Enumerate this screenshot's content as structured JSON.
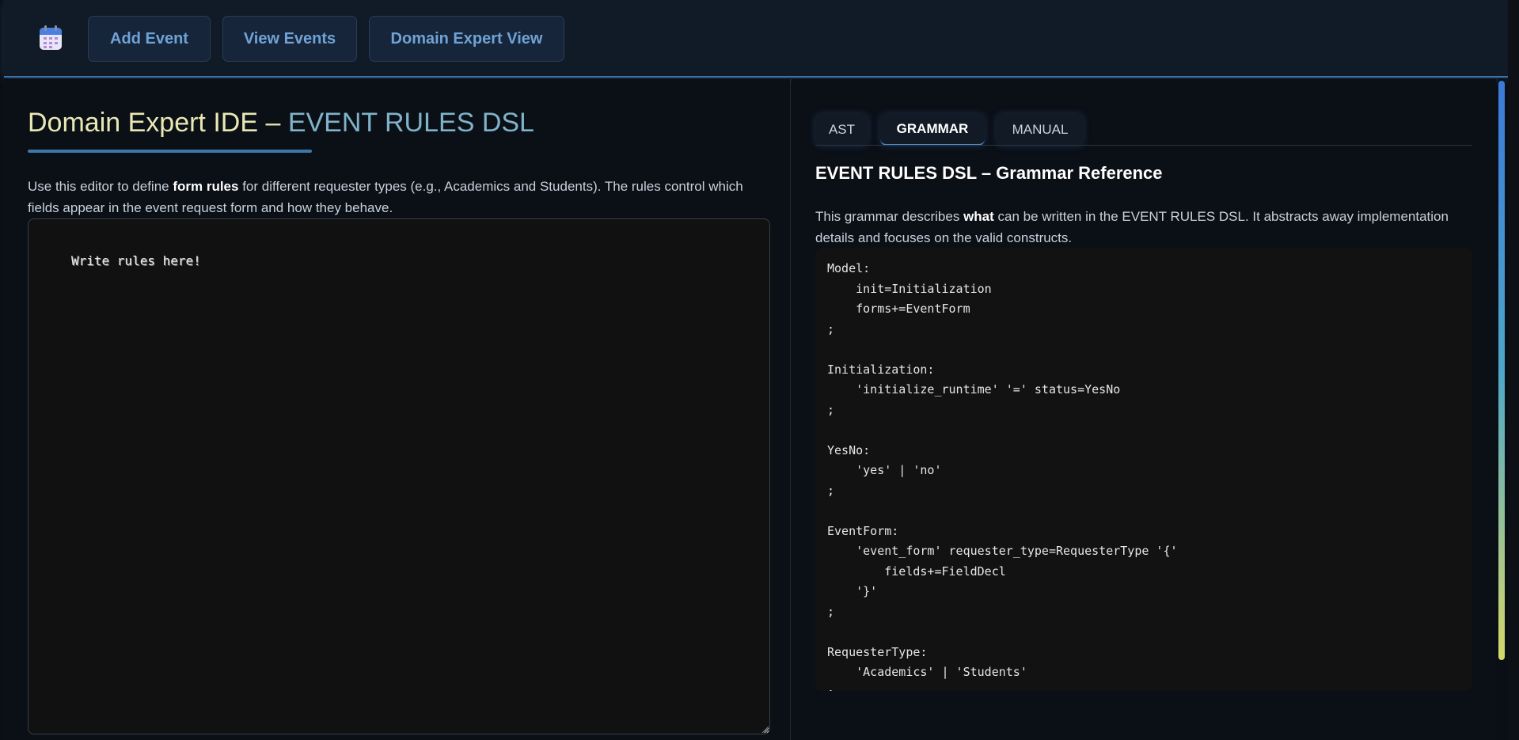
{
  "nav": {
    "app_icon": "calendar-icon",
    "buttons": [
      {
        "label": "Add Event"
      },
      {
        "label": "View Events"
      },
      {
        "label": "Domain Expert View"
      }
    ]
  },
  "left": {
    "title_part_a": "Domain Expert IDE –",
    "title_part_b": "EVENT RULES DSL",
    "intro_pre": "Use this editor to define ",
    "intro_bold": "form rules",
    "intro_post": " for different requester types (e.g., Academics and Students). The rules control which fields appear in the event request form and how they behave.",
    "editor_placeholder": "Write rules here!"
  },
  "right": {
    "tabs": [
      {
        "label": "AST",
        "active": false
      },
      {
        "label": "GRAMMAR",
        "active": true
      },
      {
        "label": "MANUAL",
        "active": false
      }
    ],
    "heading": "EVENT RULES DSL – Grammar Reference",
    "desc_pre": "This grammar describes ",
    "desc_bold": "what",
    "desc_post": " can be written in the EVENT RULES DSL. It abstracts away implementation details and focuses on the valid constructs.",
    "grammar_code": "Model:\n    init=Initialization\n    forms+=EventForm\n;\n\nInitialization:\n    'initialize_runtime' '=' status=YesNo\n;\n\nYesNo:\n    'yes' | 'no'\n;\n\nEventForm:\n    'event_form' requester_type=RequesterType '{'\n        fields+=FieldDecl\n    '}'\n;\n\nRequesterType:\n    'Academics' | 'Students'\n;\n\nFieldDecl:"
  },
  "colors": {
    "nav_bg": "#111a27",
    "nav_button_text": "#6fa3d6",
    "title_a": "#e9e8b4",
    "title_b": "#7fb3c9",
    "accent": "#3d78ad"
  }
}
